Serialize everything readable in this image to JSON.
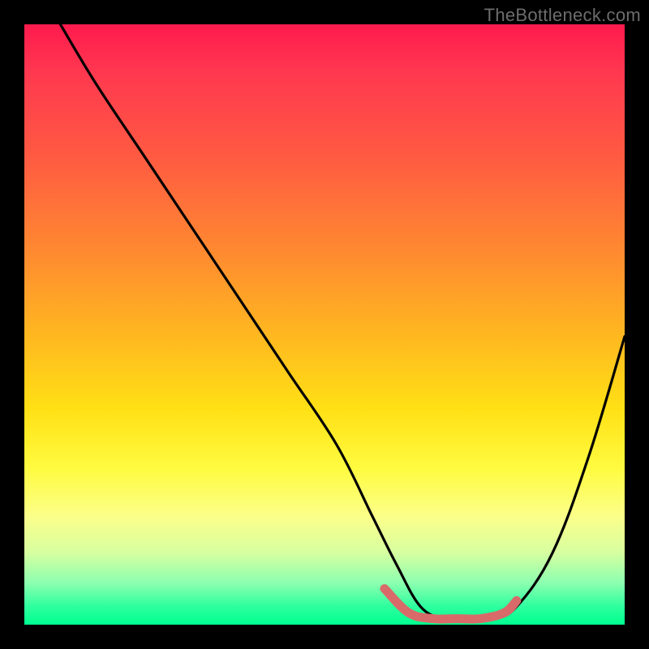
{
  "watermark": "TheBottleneck.com",
  "chart_data": {
    "type": "line",
    "title": "",
    "xlabel": "",
    "ylabel": "",
    "xlim": [
      0,
      100
    ],
    "ylim": [
      0,
      100
    ],
    "grid": false,
    "legend": false,
    "series": [
      {
        "name": "bottleneck-curve",
        "x": [
          6,
          12,
          20,
          28,
          36,
          44,
          52,
          58,
          62,
          66,
          70,
          74,
          78,
          82,
          88,
          94,
          100
        ],
        "values": [
          100,
          90,
          78,
          66,
          54,
          42,
          30,
          18,
          10,
          3,
          1,
          1,
          1,
          3,
          12,
          28,
          48
        ]
      }
    ],
    "accent_segment": {
      "comment": "pink/red thick band near the minimum",
      "x": [
        60,
        64,
        68,
        72,
        76,
        80,
        82
      ],
      "values": [
        6,
        2,
        1,
        1,
        1,
        2,
        4
      ]
    },
    "colors": {
      "curve": "#000000",
      "accent": "#d96a6a",
      "gradient_top": "#ff1a4d",
      "gradient_mid": "#ffe015",
      "gradient_bot": "#00ff90",
      "frame": "#000000",
      "watermark": "#6d6d6d"
    }
  }
}
